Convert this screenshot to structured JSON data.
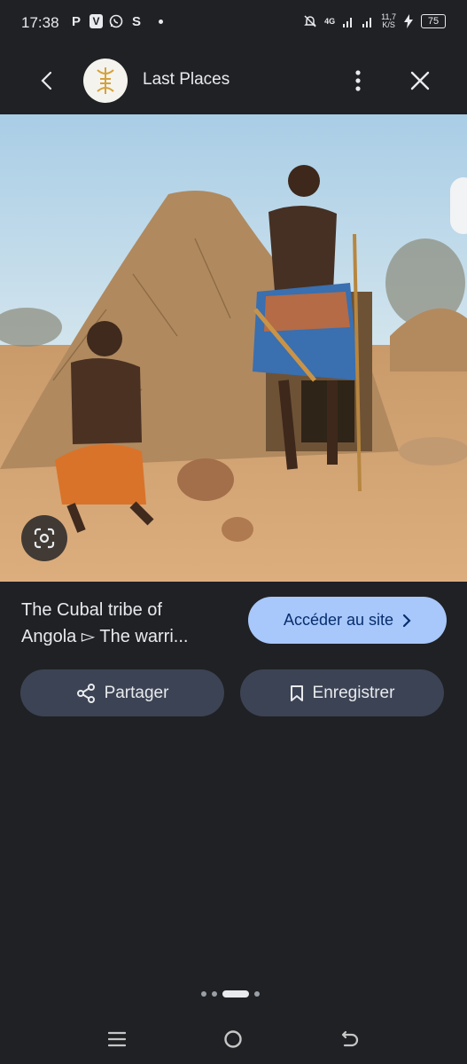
{
  "status_bar": {
    "time": "17:38",
    "left_icons": [
      "P",
      "V",
      "whatsapp",
      "S"
    ],
    "network": "4G",
    "net_speed_value": "11,7",
    "net_speed_unit": "K/S",
    "battery": "75"
  },
  "header": {
    "site_name": "Last Places"
  },
  "result": {
    "title_line1": "The Cubal tribe of",
    "title_line2": "Angola ▻ The warri...",
    "visit_label": "Accéder au site"
  },
  "actions": {
    "share_label": "Partager",
    "save_label": "Enregistrer"
  },
  "pagination": {
    "total": 4,
    "active": 2
  },
  "colors": {
    "background": "#202124",
    "visit_button": "#a8c7fa",
    "action_button": "#3c4354"
  },
  "icons": {
    "back": "back-arrow-icon",
    "more": "more-vert-icon",
    "close": "close-icon",
    "lens": "google-lens-icon",
    "share": "share-icon",
    "save": "bookmark-icon"
  }
}
